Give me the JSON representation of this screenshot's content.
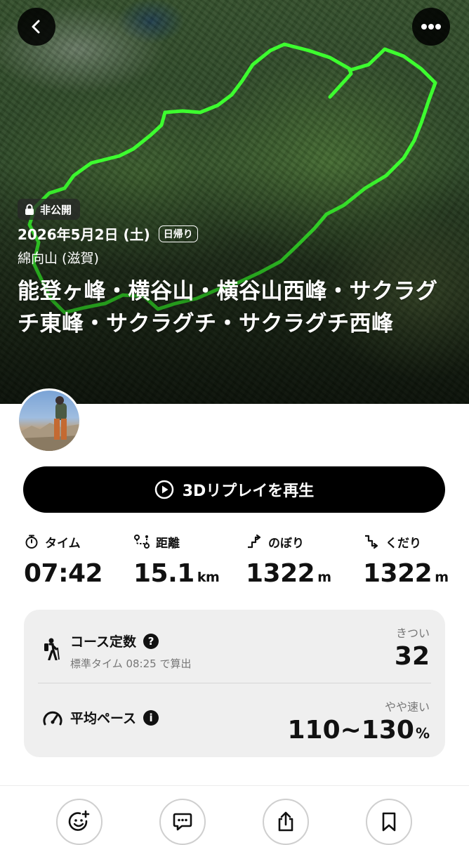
{
  "header": {
    "back_icon": "chevron-left-icon",
    "more_icon": "ellipsis-icon",
    "privacy_label": "非公開",
    "date": "2026年5月2日 (土)",
    "trip_type": "日帰り",
    "area": "綿向山 (滋賀)",
    "title": "能登ヶ峰・横谷山・横谷山西峰・サクラグチ東峰・サクラグチ・サクラグチ西峰"
  },
  "colors": {
    "track": "#3dff2f",
    "button_bg": "#000000",
    "card_bg": "#efefef"
  },
  "replay_button": {
    "icon": "play-circle-icon",
    "label": "3Dリプレイを再生"
  },
  "stats": [
    {
      "icon": "stopwatch-icon",
      "label": "タイム",
      "value": "07:42",
      "unit": ""
    },
    {
      "icon": "route-icon",
      "label": "距離",
      "value": "15.1",
      "unit": "km"
    },
    {
      "icon": "ascent-icon",
      "label": "のぼり",
      "value": "1322",
      "unit": "m"
    },
    {
      "icon": "descent-icon",
      "label": "くだり",
      "value": "1322",
      "unit": "m"
    }
  ],
  "course_constant": {
    "icon": "hiker-icon",
    "title": "コース定数",
    "help_icon": "question-circle-icon",
    "subtitle": "標準タイム 08:25 で算出",
    "level": "きつい",
    "value": "32"
  },
  "average_pace": {
    "icon": "speedometer-icon",
    "title": "平均ペース",
    "info_icon": "info-circle-icon",
    "level": "やや速い",
    "value": "110~130",
    "unit": "%"
  },
  "bottom_bar": [
    {
      "name": "reaction-button",
      "icon": "add-emoji-icon"
    },
    {
      "name": "comment-button",
      "icon": "comment-icon"
    },
    {
      "name": "share-button",
      "icon": "share-icon"
    },
    {
      "name": "bookmark-button",
      "icon": "bookmark-icon"
    }
  ]
}
